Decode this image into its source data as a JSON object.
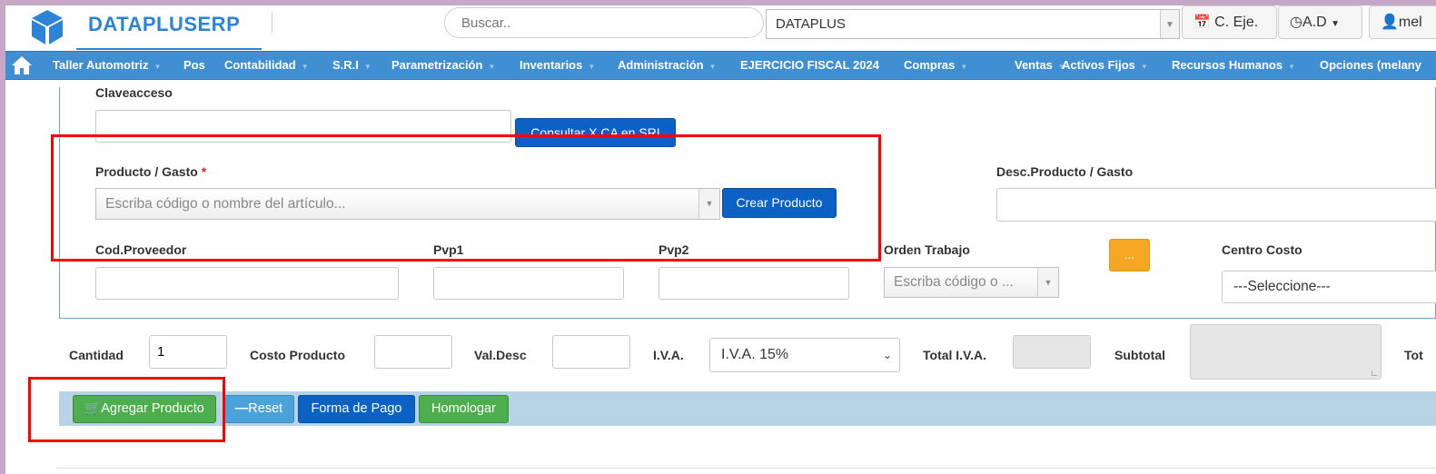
{
  "header": {
    "brand": "DATAPLUSERP",
    "search_placeholder": "Buscar..",
    "company_select": "DATAPLUS",
    "btn_exercise": "C. Eje.",
    "btn_ad": "A.D",
    "btn_user": "mel"
  },
  "nav": {
    "home_icon": "home-icon",
    "items": [
      "Taller Automotriz",
      "Pos",
      "Contabilidad",
      "S.R.I",
      "Parametrización",
      "Inventarios",
      "Administración",
      "EJERCICIO FISCAL 2024",
      "Compras",
      "Ventas",
      "Activos Fijos",
      "Recursos Humanos",
      "Opciones (melany"
    ]
  },
  "form": {
    "claveacceso_label": "Claveacceso",
    "consultar_button": "Consultar X CA en SRI",
    "producto_label": "Producto / Gasto",
    "required_mark": "*",
    "producto_placeholder": "Escriba código o nombre del artículo...",
    "crear_producto_button": "Crear Producto",
    "desc_producto_label": "Desc.Producto / Gasto",
    "cod_proveedor_label": "Cod.Proveedor",
    "pvp1_label": "Pvp1",
    "pvp2_label": "Pvp2",
    "orden_trabajo_label": "Orden Trabajo",
    "orden_trabajo_placeholder": "Escriba código o ...",
    "dots_button": "...",
    "centro_costo_label": "Centro Costo",
    "centro_costo_value": "---Seleccione---"
  },
  "line": {
    "cantidad_label": "Cantidad",
    "cantidad_value": "1",
    "costo_label": "Costo Producto",
    "valdesc_label": "Val.Desc",
    "iva_label": "I.V.A.",
    "iva_value": "I.V.A. 15%",
    "total_iva_label": "Total I.V.A.",
    "subtotal_label": "Subtotal",
    "total_label": "Tot"
  },
  "toolbar": {
    "agregar": "Agregar Producto",
    "reset": "Reset",
    "forma_pago": "Forma de Pago",
    "homologar": "Homologar"
  },
  "colors": {
    "brand": "#2b84d6",
    "navbar": "#3f8fd2",
    "primary_button": "#0b62c4",
    "success_button": "#4cae4c",
    "info_button": "#4aa3d8",
    "warning_button": "#f5a623",
    "highlight": "#ff0000"
  }
}
